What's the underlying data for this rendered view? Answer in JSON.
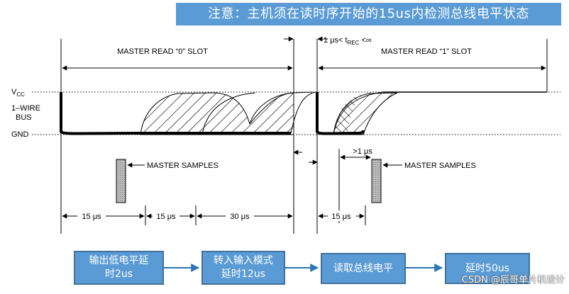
{
  "banner": {
    "note": "注意：主机须在读时序开始的15us内检测总线电平状态"
  },
  "diagram": {
    "slot0_title": "MASTER READ “0” SLOT",
    "slot1_title": "MASTER READ “1” SLOT",
    "trec_label_pre": "1 μs< t",
    "trec_label_sub": "REC",
    "trec_label_post": " <∞",
    "vcc_main": "V",
    "vcc_sub": "CC",
    "bus_line1": "1–WIRE",
    "bus_line2": "BUS",
    "gnd_label": "GND",
    "master_samples_0": "MASTER SAMPLES",
    "master_samples_1": "MASTER SAMPLES",
    "gt1us": ">1 μs",
    "dur_15us_a": "15 μs",
    "dur_15us_b": "15 μs",
    "dur_30us": "30 μs",
    "dur_15us_c": "15 μs"
  },
  "flow": {
    "step1": "输出低电平延\n时2us",
    "step2": "转入输入模式\n延时12us",
    "step3": "读取总线电平",
    "step4": "延时50us"
  },
  "watermark": "CSDN @辰哥单片机设计"
}
